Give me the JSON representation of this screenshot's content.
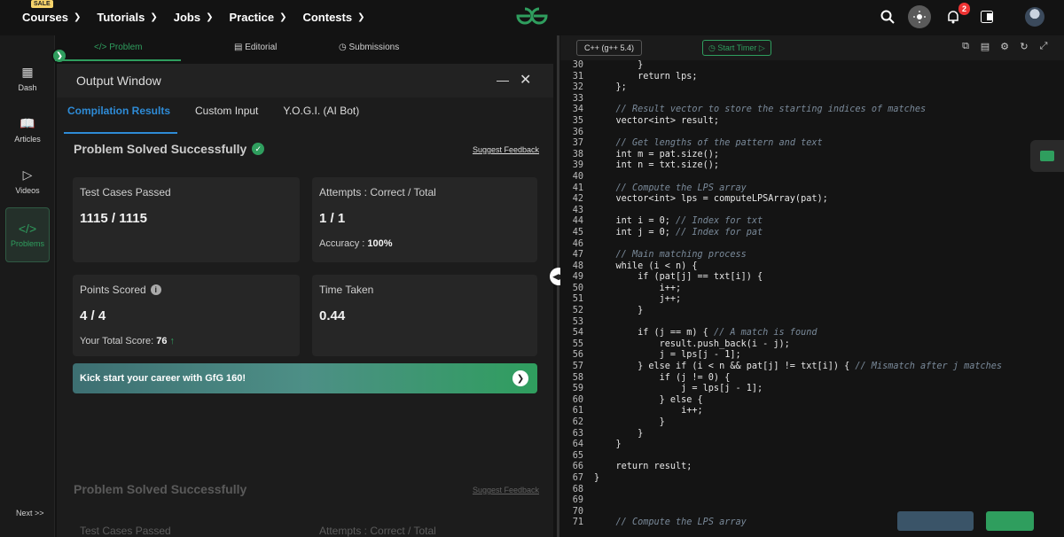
{
  "topnav": {
    "sale_badge": "SALE",
    "items": [
      {
        "label": "Courses"
      },
      {
        "label": "Tutorials"
      },
      {
        "label": "Jobs"
      },
      {
        "label": "Practice"
      },
      {
        "label": "Contests"
      }
    ],
    "notification_count": "2"
  },
  "sidebar": {
    "items": [
      {
        "label": "Dash",
        "icon": "grid-icon"
      },
      {
        "label": "Articles",
        "icon": "book-icon"
      },
      {
        "label": "Videos",
        "icon": "play-icon"
      },
      {
        "label": "Problems",
        "icon": "code-icon"
      }
    ],
    "next_label": "Next >>"
  },
  "problem_tabs": {
    "problem": "</> Problem",
    "editorial": "Editorial",
    "submissions": "Submissions"
  },
  "output_window": {
    "title": "Output Window",
    "tabs": [
      "Compilation Results",
      "Custom Input",
      "Y.O.G.I. (AI Bot)"
    ],
    "status": "Problem Solved Successfully",
    "suggest_feedback": "Suggest Feedback",
    "test_cases_label": "Test Cases Passed",
    "test_cases_value": "1115 / 1115",
    "attempts_label": "Attempts : Correct / Total",
    "attempts_value": "1 / 1",
    "accuracy_label": "Accuracy :",
    "accuracy_value": "100%",
    "points_label": "Points Scored",
    "points_value": "4 / 4",
    "total_score_label": "Your Total Score:",
    "total_score_value": "76",
    "time_label": "Time Taken",
    "time_value": "0.44",
    "banner_text": "Kick start your career with GfG 160!"
  },
  "editor": {
    "language": "C++ (g++ 5.4)",
    "timer_label": "Start Timer",
    "lines": [
      {
        "n": "30",
        "t": "        }",
        "c": ""
      },
      {
        "n": "31",
        "t": "        return lps;",
        "c": ""
      },
      {
        "n": "32",
        "t": "    };",
        "c": ""
      },
      {
        "n": "33",
        "t": "",
        "c": ""
      },
      {
        "n": "34",
        "t": "    ",
        "c": "// Result vector to store the starting indices of matches"
      },
      {
        "n": "35",
        "t": "    vector<int> result;",
        "c": ""
      },
      {
        "n": "36",
        "t": "",
        "c": ""
      },
      {
        "n": "37",
        "t": "    ",
        "c": "// Get lengths of the pattern and text"
      },
      {
        "n": "38",
        "t": "    int m = pat.size();",
        "c": ""
      },
      {
        "n": "39",
        "t": "    int n = txt.size();",
        "c": ""
      },
      {
        "n": "40",
        "t": "",
        "c": ""
      },
      {
        "n": "41",
        "t": "    ",
        "c": "// Compute the LPS array"
      },
      {
        "n": "42",
        "t": "    vector<int> lps = computeLPSArray(pat);",
        "c": ""
      },
      {
        "n": "43",
        "t": "",
        "c": ""
      },
      {
        "n": "44",
        "t": "    int i = 0; ",
        "c": "// Index for txt"
      },
      {
        "n": "45",
        "t": "    int j = 0; ",
        "c": "// Index for pat"
      },
      {
        "n": "46",
        "t": "",
        "c": ""
      },
      {
        "n": "47",
        "t": "    ",
        "c": "// Main matching process"
      },
      {
        "n": "48",
        "t": "    while (i < n) {",
        "c": ""
      },
      {
        "n": "49",
        "t": "        if (pat[j] == txt[i]) {",
        "c": ""
      },
      {
        "n": "50",
        "t": "            i++;",
        "c": ""
      },
      {
        "n": "51",
        "t": "            j++;",
        "c": ""
      },
      {
        "n": "52",
        "t": "        }",
        "c": ""
      },
      {
        "n": "53",
        "t": "",
        "c": ""
      },
      {
        "n": "54",
        "t": "        if (j == m) { ",
        "c": "// A match is found"
      },
      {
        "n": "55",
        "t": "            result.push_back(i - j);",
        "c": ""
      },
      {
        "n": "56",
        "t": "            j = lps[j - 1];",
        "c": ""
      },
      {
        "n": "57",
        "t": "        } else if (i < n && pat[j] != txt[i]) { ",
        "c": "// Mismatch after j matches"
      },
      {
        "n": "58",
        "t": "            if (j != 0) {",
        "c": ""
      },
      {
        "n": "59",
        "t": "                j = lps[j - 1];",
        "c": ""
      },
      {
        "n": "60",
        "t": "            } else {",
        "c": ""
      },
      {
        "n": "61",
        "t": "                i++;",
        "c": ""
      },
      {
        "n": "62",
        "t": "            }",
        "c": ""
      },
      {
        "n": "63",
        "t": "        }",
        "c": ""
      },
      {
        "n": "64",
        "t": "    }",
        "c": ""
      },
      {
        "n": "65",
        "t": "",
        "c": ""
      },
      {
        "n": "66",
        "t": "    return result;",
        "c": ""
      },
      {
        "n": "67",
        "t": "}",
        "c": ""
      },
      {
        "n": "68",
        "t": "",
        "c": ""
      },
      {
        "n": "69",
        "t": "",
        "c": ""
      },
      {
        "n": "70",
        "t": "",
        "c": ""
      },
      {
        "n": "71",
        "t": "    ",
        "c": "// Compute the LPS array"
      }
    ]
  },
  "colors": {
    "accent_green": "#2f9e5e",
    "accent_blue": "#2e8bd6",
    "background": "#131313"
  }
}
